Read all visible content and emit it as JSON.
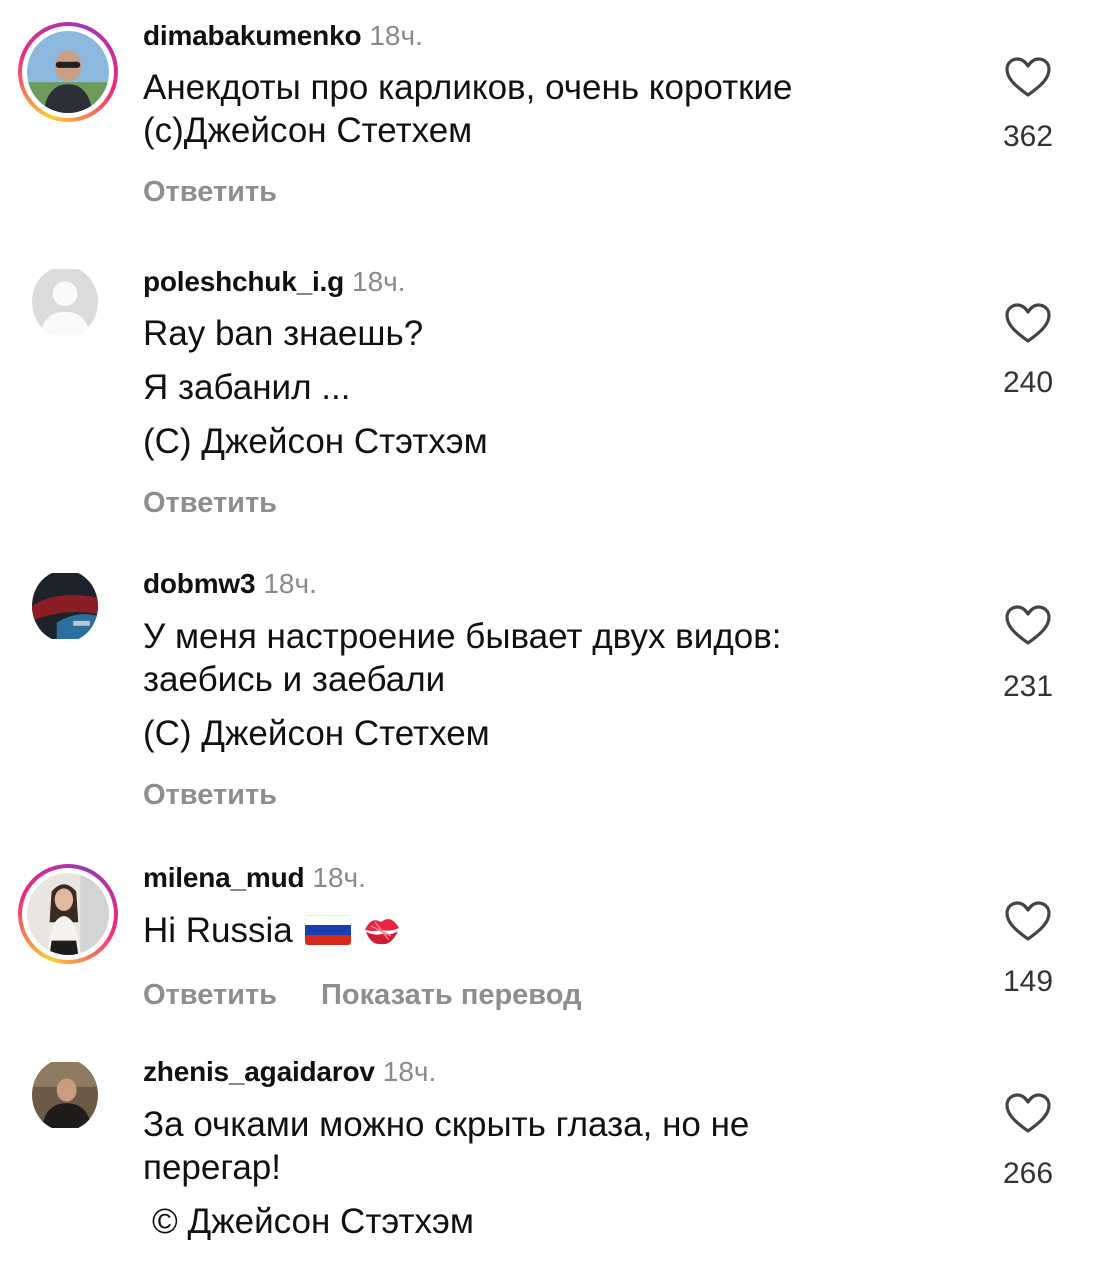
{
  "comments": [
    {
      "username": "dimabakumenko",
      "time": "18ч.",
      "lines": [
        "Анекдоты про карликов, очень короткие",
        "(с)Джейсон Стетхем"
      ],
      "likes": "362",
      "actions": [
        "Ответить"
      ]
    },
    {
      "username": "poleshchuk_i.g",
      "time": "18ч.",
      "lines": [
        "Ray ban знаешь?",
        "Я забанил ...",
        "(С) Джейсон Стэтхэм"
      ],
      "likes": "240",
      "actions": [
        "Ответить"
      ]
    },
    {
      "username": "dobmw3",
      "time": "18ч.",
      "lines": [
        "У меня настроение бывает двух видов:",
        "заебись и заебали",
        "(С) Джейсон Стетхем"
      ],
      "likes": "231",
      "actions": [
        "Ответить"
      ]
    },
    {
      "username": "milena_mud",
      "time": "18ч.",
      "lines": [
        "Hi Russia"
      ],
      "likes": "149",
      "actions": [
        "Ответить",
        "Показать перевод"
      ]
    },
    {
      "username": "zhenis_agaidarov",
      "time": "18ч.",
      "lines": [
        "За очками можно скрыть глаза, но не",
        "перегар!",
        "© Джейсон Стэтхэм"
      ],
      "likes": "266",
      "actions": []
    }
  ],
  "icons": {
    "like": "heart-outline-icon",
    "flag": "russia-flag-icon",
    "emoji": "kiss-mark-icon"
  },
  "colors": {
    "username": "#111111",
    "secondary": "#8e8e8e",
    "story_ring": [
      "#f9ce34",
      "#ee2a7b",
      "#9b36b7"
    ]
  }
}
